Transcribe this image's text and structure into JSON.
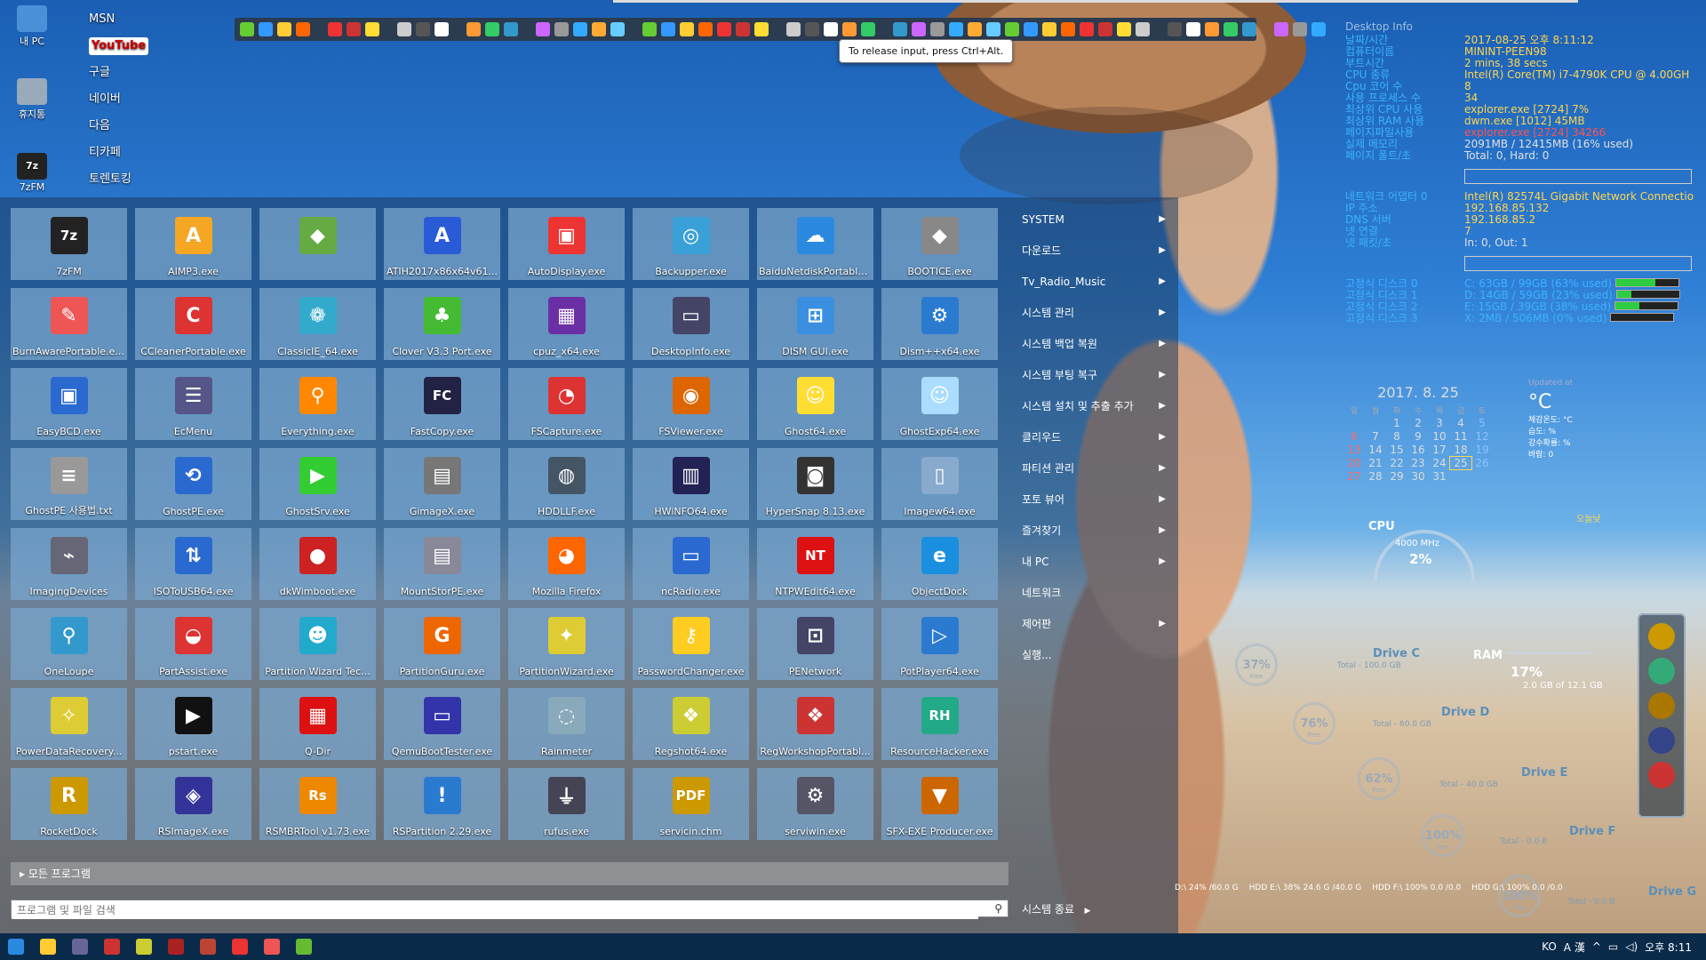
{
  "desktop": {
    "icons": [
      {
        "label": "내 PC"
      },
      {
        "label": "휴지통"
      },
      {
        "label": "7zFM"
      }
    ],
    "links": [
      "MSN",
      "YouTube",
      "구글",
      "네이버",
      "다음",
      "티카페",
      "토렌토킹"
    ]
  },
  "tooltip": "To release input, press Ctrl+Alt.",
  "start_menu": {
    "tiles": [
      {
        "label": "7zFM",
        "icon": "7z",
        "color": "#222"
      },
      {
        "label": "AIMP3.exe",
        "icon": "A",
        "color": "#f5a623"
      },
      {
        "label": "",
        "icon": "◆",
        "color": "#6a4"
      },
      {
        "label": "ATIH2017x86x64v61...",
        "icon": "A",
        "color": "#2a5bd7"
      },
      {
        "label": "AutoDisplay.exe",
        "icon": "▣",
        "color": "#e33"
      },
      {
        "label": "Backupper.exe",
        "icon": "◎",
        "color": "#3aa0d8"
      },
      {
        "label": "BaiduNetdiskPortable...",
        "icon": "☁",
        "color": "#2b8ae0"
      },
      {
        "label": "BOOTICE.exe",
        "icon": "◆",
        "color": "#888"
      },
      {
        "label": "BurnAwarePortable.exe",
        "icon": "✎",
        "color": "#e55"
      },
      {
        "label": "CCleanerPortable.exe",
        "icon": "C",
        "color": "#d33"
      },
      {
        "label": "ClassicIE_64.exe",
        "icon": "❁",
        "color": "#3ac"
      },
      {
        "label": "Clover V3.3 Port.exe",
        "icon": "♣",
        "color": "#4b3"
      },
      {
        "label": "cpuz_x64.exe",
        "icon": "▦",
        "color": "#6b2fa5"
      },
      {
        "label": "DesktopInfo.exe",
        "icon": "▭",
        "color": "#446"
      },
      {
        "label": "DISM GUI.exe",
        "icon": "⊞",
        "color": "#3a8fe0"
      },
      {
        "label": "Dism++x64.exe",
        "icon": "⚙",
        "color": "#2a7ad0"
      },
      {
        "label": "EasyBCD.exe",
        "icon": "▣",
        "color": "#2a6ad0"
      },
      {
        "label": "EcMenu",
        "icon": "☰",
        "color": "#558"
      },
      {
        "label": "Everything.exe",
        "icon": "⚲",
        "color": "#f80"
      },
      {
        "label": "FastCopy.exe",
        "icon": "FC",
        "color": "#224"
      },
      {
        "label": "FSCapture.exe",
        "icon": "◔",
        "color": "#d33"
      },
      {
        "label": "FSViewer.exe",
        "icon": "◉",
        "color": "#d60"
      },
      {
        "label": "Ghost64.exe",
        "icon": "☺",
        "color": "#fd3"
      },
      {
        "label": "GhostExp64.exe",
        "icon": "☺",
        "color": "#adf"
      },
      {
        "label": "GhostPE 사용법.txt",
        "icon": "≡",
        "color": "#999"
      },
      {
        "label": "GhostPE.exe",
        "icon": "⟲",
        "color": "#2a6ad0"
      },
      {
        "label": "GhostSrv.exe",
        "icon": "▶",
        "color": "#3c3"
      },
      {
        "label": "GimageX.exe",
        "icon": "▤",
        "color": "#777"
      },
      {
        "label": "HDDLLF.exe",
        "icon": "◍",
        "color": "#456"
      },
      {
        "label": "HWiNFO64.exe",
        "icon": "▥",
        "color": "#225"
      },
      {
        "label": "HyperSnap 8.13.exe",
        "icon": "◙",
        "color": "#333"
      },
      {
        "label": "Imagew64.exe",
        "icon": "▯",
        "color": "#8ac"
      },
      {
        "label": "ImagingDevices",
        "icon": "⌁",
        "color": "#667"
      },
      {
        "label": "ISOToUSB64.exe",
        "icon": "⇅",
        "color": "#2a6ad0"
      },
      {
        "label": "dkWimboot.exe",
        "icon": "●",
        "color": "#c22"
      },
      {
        "label": "MountStorPE.exe",
        "icon": "▤",
        "color": "#889"
      },
      {
        "label": "Mozilla Firefox",
        "icon": "◕",
        "color": "#f60"
      },
      {
        "label": "ncRadio.exe",
        "icon": "▭",
        "color": "#2a6ad0"
      },
      {
        "label": "NTPWEdit64.exe",
        "icon": "NT",
        "color": "#d11"
      },
      {
        "label": "ObjectDock",
        "icon": "e",
        "color": "#1a8fe0"
      },
      {
        "label": "OneLoupe",
        "icon": "⚲",
        "color": "#39c"
      },
      {
        "label": "PartAssist.exe",
        "icon": "◒",
        "color": "#d33"
      },
      {
        "label": "Partition Wizard Tec...",
        "icon": "☻",
        "color": "#2ac"
      },
      {
        "label": "PartitionGuru.exe",
        "icon": "G",
        "color": "#e60"
      },
      {
        "label": "PartitionWizard.exe",
        "icon": "✦",
        "color": "#dc3"
      },
      {
        "label": "PasswordChanger.exe",
        "icon": "⚷",
        "color": "#fc2"
      },
      {
        "label": "PENetwork",
        "icon": "⊡",
        "color": "#446"
      },
      {
        "label": "PotPlayer64.exe",
        "icon": "▷",
        "color": "#2a7ad0"
      },
      {
        "label": "PowerDataRecovery...",
        "icon": "✧",
        "color": "#dc3"
      },
      {
        "label": "pstart.exe",
        "icon": "▶",
        "color": "#111"
      },
      {
        "label": "Q-Dir",
        "icon": "▦",
        "color": "#d11"
      },
      {
        "label": "QemuBootTester.exe",
        "icon": "▭",
        "color": "#33a"
      },
      {
        "label": "Rainmeter",
        "icon": "◌",
        "color": "#8ab"
      },
      {
        "label": "Regshot64.exe",
        "icon": "❖",
        "color": "#cc3"
      },
      {
        "label": "RegWorkshopPortabl...",
        "icon": "❖",
        "color": "#c33"
      },
      {
        "label": "ResourceHacker.exe",
        "icon": "RH",
        "color": "#2a8"
      },
      {
        "label": "RocketDock",
        "icon": "R",
        "color": "#c90"
      },
      {
        "label": "RSImageX.exe",
        "icon": "◈",
        "color": "#339"
      },
      {
        "label": "RSMBRTool v1.73.exe",
        "icon": "Rs",
        "color": "#e80"
      },
      {
        "label": "RSPartition 2.29.exe",
        "icon": "!",
        "color": "#2a7ad0"
      },
      {
        "label": "rufus.exe",
        "icon": "⏚",
        "color": "#445"
      },
      {
        "label": "servicin.chm",
        "icon": "PDF",
        "color": "#c90"
      },
      {
        "label": "serviwin.exe",
        "icon": "⚙",
        "color": "#556"
      },
      {
        "label": "SFX-EXE Producer.exe",
        "icon": "▼",
        "color": "#c60"
      }
    ],
    "all_programs": "모든 프로그램",
    "search_placeholder": "프로그램 및 파일 검색",
    "side_items": [
      {
        "label": "SYSTEM",
        "arrow": "▶"
      },
      {
        "label": "다운로드",
        "arrow": "▶"
      },
      {
        "label": "Tv_Radio_Music",
        "arrow": "▶"
      },
      {
        "label": "시스템 관리",
        "arrow": "▶"
      },
      {
        "label": "시스템 백업 복원",
        "arrow": "▶"
      },
      {
        "label": "시스템 부팅 복구",
        "arrow": "▶"
      },
      {
        "label": "시스템 설치 및 추출 추가",
        "arrow": "▶"
      },
      {
        "label": "클리우드",
        "arrow": "▶"
      },
      {
        "label": "파티션 관리",
        "arrow": "▶"
      },
      {
        "label": "포토 뷰어",
        "arrow": "▶"
      },
      {
        "label": "즐겨찾기",
        "arrow": "▶"
      },
      {
        "label": "내 PC",
        "arrow": "▶"
      },
      {
        "label": "네트워크",
        "arrow": ""
      },
      {
        "label": "제어판",
        "arrow": "▶"
      },
      {
        "label": "실행...",
        "arrow": ""
      }
    ],
    "shutdown": "시스템 종료",
    "shutdown_arrow": "▶"
  },
  "desktop_info": {
    "title": "Desktop Info",
    "rows": [
      {
        "k": "날짜/시간",
        "v": "2017-08-25 오후 8:11:12",
        "c": "y"
      },
      {
        "k": "컴퓨터이름",
        "v": "MININT-PEEN98",
        "c": "y"
      },
      {
        "k": "부트시간",
        "v": "2 mins, 38 secs",
        "c": "y"
      },
      {
        "k": "CPU 종류",
        "v": "Intel(R) Core(TM) i7-4790K CPU @ 4.00GH",
        "c": "y"
      },
      {
        "k": "Cpu 코어 수",
        "v": "8",
        "c": "y"
      },
      {
        "k": "사용 프로세스 수",
        "v": "34",
        "c": "y"
      },
      {
        "k": "최상위 CPU 사용",
        "v": "explorer.exe [2724] 7%",
        "c": "y"
      },
      {
        "k": "최상위 RAM 사용",
        "v": "dwm.exe [1012] 45MB",
        "c": "y"
      },
      {
        "k": "페이지파일사용",
        "v": "explorer.exe [2724] 34266",
        "c": "r"
      },
      {
        "k": "실제 메모리",
        "v": "2091MB / 12415MB (16% used)",
        "c": "w"
      },
      {
        "k": "페이지 폴트/초",
        "v": "Total: 0, Hard: 0",
        "c": "w"
      }
    ],
    "net_rows": [
      {
        "k": "네트워크 어댑터 0",
        "v": "Intel(R) 82574L Gigabit Network Connectio",
        "c": "y"
      },
      {
        "k": "IP 주소",
        "v": "192.168.85.132",
        "c": "y"
      },
      {
        "k": "DNS 서버",
        "v": "192.168.85.2",
        "c": "y"
      },
      {
        "k": "넷 연결",
        "v": "7",
        "c": "y"
      },
      {
        "k": "넷 패킷/초",
        "v": "In: 0, Out: 1",
        "c": "w"
      }
    ],
    "disk_rows": [
      {
        "k": "고정식 디스크 0",
        "v": "C: 63GB / 99GB (63% used)",
        "pct": 63
      },
      {
        "k": "고정식 디스크 1",
        "v": "D: 14GB / 59GB (23% used)",
        "pct": 23
      },
      {
        "k": "고정식 디스크 2",
        "v": "E: 15GB / 39GB (38% used)",
        "pct": 38
      },
      {
        "k": "고정식 디스크 3",
        "v": "X: 2MB / 506MB (0% used)",
        "pct": 0
      }
    ]
  },
  "calendar": {
    "header": "2017. 8. 25",
    "dows": [
      "일",
      "월",
      "화",
      "수",
      "목",
      "금",
      "토"
    ],
    "days": [
      "",
      "",
      "1",
      "2",
      "3",
      "4",
      "5",
      "6",
      "7",
      "8",
      "9",
      "10",
      "11",
      "12",
      "13",
      "14",
      "15",
      "16",
      "17",
      "18",
      "19",
      "20",
      "21",
      "22",
      "23",
      "24",
      "25",
      "26",
      "27",
      "28",
      "29",
      "30",
      "31"
    ],
    "today": "25"
  },
  "weather": {
    "updated": "Updated at",
    "temp": "°C",
    "lines": [
      "체감온도: °C",
      "습도: %",
      "강수확률: %",
      "바람: 0"
    ],
    "day": "오늘낮"
  },
  "gauges": {
    "cpu_label": "CPU",
    "cpu_freq": "4000 MHz",
    "cpu_pct": "2%",
    "ram_label": "RAM",
    "ram_pct": "17%",
    "ram_detail": "2.0 GB of 12.1 GB"
  },
  "drives": [
    {
      "name": "Drive C",
      "pct": "37%",
      "total": "Total - 100.0 GB"
    },
    {
      "name": "Drive D",
      "pct": "76%",
      "total": "Total - 60.0 GB"
    },
    {
      "name": "Drive E",
      "pct": "62%",
      "total": "Total - 40.0 GB"
    },
    {
      "name": "Drive F",
      "pct": "100%",
      "total": "Total - 0.0 B"
    },
    {
      "name": "Drive G",
      "pct": "100%",
      "total": "Total - 0.0 B"
    }
  ],
  "ring_sub": "Free",
  "hdd_strip": [
    "D:\\ 24% /60.0 G",
    "HDD E:\\ 38% 24.6 G /40.0 G",
    "HDD F:\\ 100% 0.0 /0.0",
    "HDD G:\\ 100% 0.0 /0.0"
  ],
  "taskbar": {
    "tray_text": "KO",
    "ime": "A 漢",
    "clock": "오후 8:11"
  },
  "colors": {
    "accent_blue": "#3bb3ff",
    "info_yellow": "#ffd54f",
    "info_red": "#ff5252"
  }
}
